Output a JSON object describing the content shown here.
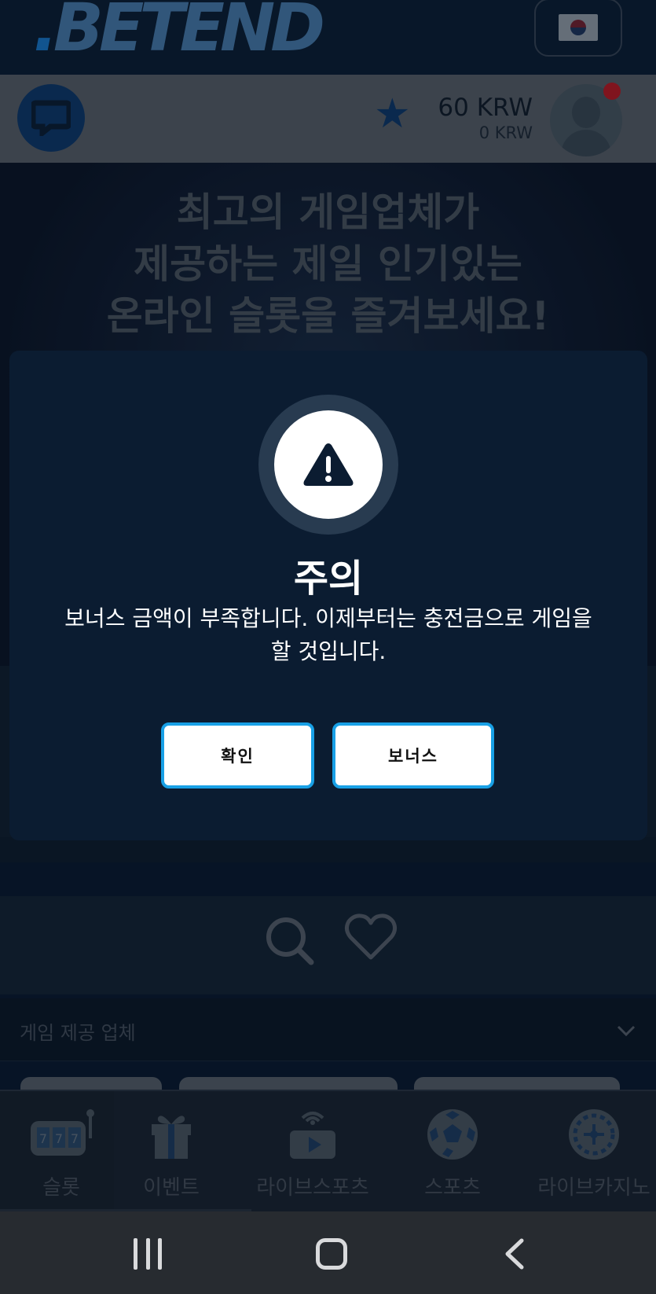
{
  "header": {
    "logo_text_prefix": ".",
    "logo_text_main": "BETEND",
    "language_flag": "korea-flag-icon"
  },
  "account": {
    "balance_main": "60 KRW",
    "balance_sub": "0 KRW"
  },
  "banner": {
    "line1": "최고의 게임업체가",
    "line2": "제공하는 제일 인기있는",
    "line3": "온라인 슬롯을 즐겨보세요!"
  },
  "providers": {
    "label": "게임 제공 업체"
  },
  "bottom_nav": {
    "items": [
      {
        "label": "슬롯",
        "icon": "slot-machine-icon"
      },
      {
        "label": "이벤트",
        "icon": "gift-icon"
      },
      {
        "label": "라이브스포츠",
        "icon": "live-play-icon"
      },
      {
        "label": "스포츠",
        "icon": "soccer-ball-icon"
      },
      {
        "label": "라이브카지노",
        "icon": "roulette-icon"
      }
    ]
  },
  "modal": {
    "title": "주의",
    "message": "보너스 금액이 부족합니다. 이제부터는 충전금으로 게임을 할 것입니다.",
    "confirm_label": "확인",
    "bonus_label": "보너스"
  },
  "colors": {
    "accent": "#18a0e6",
    "modal_bg": "#0b1c31",
    "notification": "#c31a22"
  }
}
